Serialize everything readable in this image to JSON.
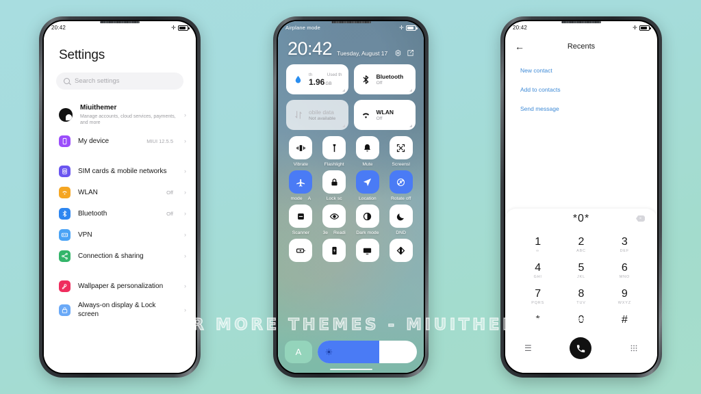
{
  "background": {
    "color_top": "#a8dde0",
    "color_bottom": "#a6ddcb"
  },
  "watermark": {
    "text": "VISIT FOR MORE THEMES - MIUITHEMER.COM"
  },
  "left_phone": {
    "status_bar": {
      "time": "20:42",
      "airplane_icon": "airplane-icon",
      "battery_icon": "battery-icon"
    },
    "title": "Settings",
    "search": {
      "placeholder": "Search settings",
      "icon": "search-icon"
    },
    "items": [
      {
        "title": "Miuithemer",
        "subtitle": "Manage accounts, cloud services, payments, and more",
        "value": "",
        "icon": "account-avatar",
        "color": "#111111"
      },
      {
        "title": "My device",
        "subtitle": "",
        "value": "MIUI 12.5.5",
        "icon": "device-icon",
        "color": "#9b4dfb"
      },
      {
        "gap": true
      },
      {
        "title": "SIM cards & mobile networks",
        "subtitle": "",
        "value": "",
        "icon": "sim-card-icon",
        "color": "#6a55f0"
      },
      {
        "title": "WLAN",
        "subtitle": "",
        "value": "Off",
        "icon": "wifi-icon",
        "color": "#f5a623"
      },
      {
        "title": "Bluetooth",
        "subtitle": "",
        "value": "Off",
        "icon": "bluetooth-icon",
        "color": "#2e86f0"
      },
      {
        "title": "VPN",
        "subtitle": "",
        "value": "",
        "icon": "vpn-icon",
        "color": "#4aa3f5"
      },
      {
        "title": "Connection & sharing",
        "subtitle": "",
        "value": "",
        "icon": "share-icon",
        "color": "#34b56a"
      },
      {
        "gap": true
      },
      {
        "title": "Wallpaper & personalization",
        "subtitle": "",
        "value": "",
        "icon": "wallpaper-icon",
        "color": "#ef2d5e"
      },
      {
        "title": "Always-on display & Lock screen",
        "subtitle": "",
        "value": "",
        "icon": "lock-icon",
        "color": "#6aa9f7"
      }
    ]
  },
  "mid_phone": {
    "status_bar": {
      "label": "Airplane mode",
      "airplane_icon": "airplane-icon",
      "battery_icon": "battery-icon"
    },
    "clock": "20:42",
    "date": "Tuesday, August 17",
    "header_icons": [
      "settings-gear-icon",
      "edit-icon"
    ],
    "cards": [
      {
        "name": "data-usage-card",
        "top_left": "th",
        "top_right": "Used th",
        "value": "1.96",
        "unit": "GB",
        "icon": "data-drop-icon",
        "dim": false
      },
      {
        "name": "bluetooth-card",
        "title": "Bluetooth",
        "subtitle": "Off",
        "icon": "bluetooth-icon",
        "dim": false
      },
      {
        "name": "mobile-data-card",
        "title": "obile data",
        "subtitle": "Not available",
        "icon": "mobile-data-icon",
        "dim": true
      },
      {
        "name": "wlan-card",
        "title": "WLAN",
        "subtitle": "Off",
        "icon": "wifi-icon",
        "dim": false
      }
    ],
    "toggles": [
      {
        "label": "Vibrate",
        "icon": "vibrate-icon",
        "on": false
      },
      {
        "label": "Flashlight",
        "icon": "flashlight-icon",
        "on": false
      },
      {
        "label": "Mute",
        "icon": "bell-icon",
        "on": false
      },
      {
        "label": "Screensl",
        "icon": "screenshot-icon",
        "on": false
      },
      {
        "label": "mode",
        "label2": "A",
        "icon": "airplane-icon",
        "on": true
      },
      {
        "label": "Lock sc",
        "icon": "lock-icon",
        "on": false
      },
      {
        "label": "Location",
        "icon": "location-arrow-icon",
        "on": true
      },
      {
        "label": "Rotate off",
        "icon": "rotate-lock-icon",
        "on": true
      },
      {
        "label": "Scanner",
        "icon": "scanner-icon",
        "on": false
      },
      {
        "label": "3e",
        "label2": "Readi",
        "icon": "eye-icon",
        "on": false
      },
      {
        "label": "Dark mode",
        "icon": "contrast-icon",
        "on": false
      },
      {
        "label": "DND",
        "icon": "moon-icon",
        "on": false
      },
      {
        "label": "",
        "icon": "battery-saver-icon",
        "on": false
      },
      {
        "label": "",
        "icon": "power-icon",
        "on": false
      },
      {
        "label": "",
        "icon": "cast-icon",
        "on": false
      },
      {
        "label": "",
        "icon": "theme-icon",
        "on": false
      }
    ],
    "brightness": {
      "auto_label": "A",
      "level_percent": 62,
      "icon": "brightness-icon"
    }
  },
  "right_phone": {
    "status_bar": {
      "time": "20:42",
      "airplane_icon": "airplane-icon",
      "battery_icon": "battery-icon"
    },
    "back_icon": "back-arrow-icon",
    "title": "Recents",
    "links": [
      "New contact",
      "Add to contacts",
      "Send message"
    ],
    "dial_number": "*0*",
    "delete_icon": "backspace-icon",
    "keys": [
      {
        "digit": "1",
        "sub": "∞"
      },
      {
        "digit": "2",
        "sub": "ABC"
      },
      {
        "digit": "3",
        "sub": "DEF"
      },
      {
        "digit": "4",
        "sub": "GHI"
      },
      {
        "digit": "5",
        "sub": "JKL"
      },
      {
        "digit": "6",
        "sub": "MNO"
      },
      {
        "digit": "7",
        "sub": "PQRS"
      },
      {
        "digit": "8",
        "sub": "TUV"
      },
      {
        "digit": "9",
        "sub": "WXYZ"
      },
      {
        "digit": "*",
        "sub": ""
      },
      {
        "digit": "0",
        "sub": ""
      },
      {
        "digit": "#",
        "sub": ""
      }
    ],
    "actions": {
      "menu_icon": "menu-icon",
      "call_icon": "phone-call-icon",
      "keypad_icon": "keypad-icon"
    }
  }
}
